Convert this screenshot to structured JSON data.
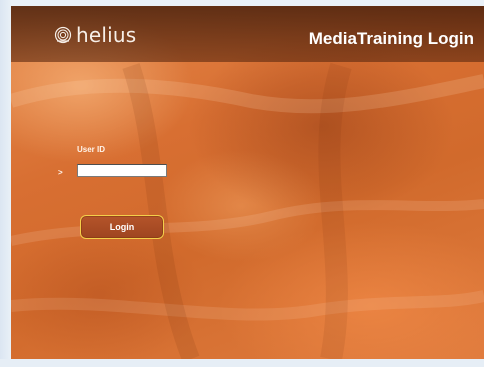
{
  "header": {
    "logo_text": "helius",
    "title": "MediaTraining Login"
  },
  "form": {
    "user_id_label": "User ID",
    "prompt_marker": ">",
    "user_id_value": "",
    "login_label": "Login"
  },
  "colors": {
    "background_orange": "#d86f32",
    "header_brown": "#5f2a10",
    "button_fill": "#a94b24",
    "button_border": "#f4cf4a"
  },
  "icons": {
    "logo": "helius-swirl-icon"
  }
}
